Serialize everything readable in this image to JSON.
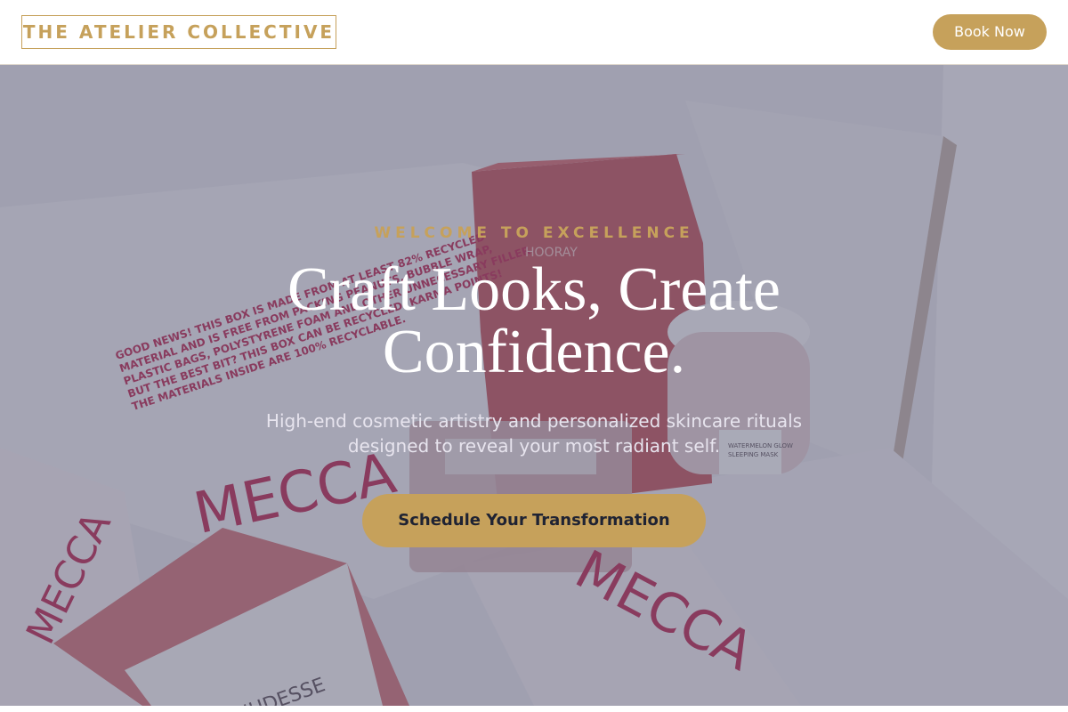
{
  "header": {
    "logo_text": "THE ATELIER COLLECTIVE",
    "book_button": "Book Now"
  },
  "hero": {
    "eyebrow": "WELCOME TO EXCELLENCE",
    "headline": "Craft Looks, Create Confidence.",
    "subtext": "High-end cosmetic artistry and personalized skincare rituals designed to reveal your most radiant self.",
    "cta_button": "Schedule Your Transformation",
    "background_image": {
      "box_print": "GOOD NEWS! THIS BOX IS MADE FROM AT LEAST 82% RECYCLED MATERIAL AND IS FREE FROM PACKING PEANUTS, BUBBLE WRAP, PLASTIC BAGS, POLYSTYRENE FOAM AND OTHER UNNECESSARY FILLER. BUT THE BEST BIT? THIS BOX CAN BE RECYCLED. KARMA POINTS! THE MATERIALS INSIDE ARE 100% RECYCLABLE.",
      "brand_wordmark": "MECCA",
      "candle_label": "NUDESSE",
      "box_label": "HOORAY",
      "jar_label": "WATERMELON GLOW SLEEPING MASK"
    }
  },
  "colors": {
    "accent_gold": "#c6a15b",
    "overlay": "#3c3e5c",
    "text_light": "#ffffff",
    "cta_text": "#1f2333"
  },
  "icons": [
    "candle-icon",
    "jar-icon",
    "box-icon"
  ]
}
